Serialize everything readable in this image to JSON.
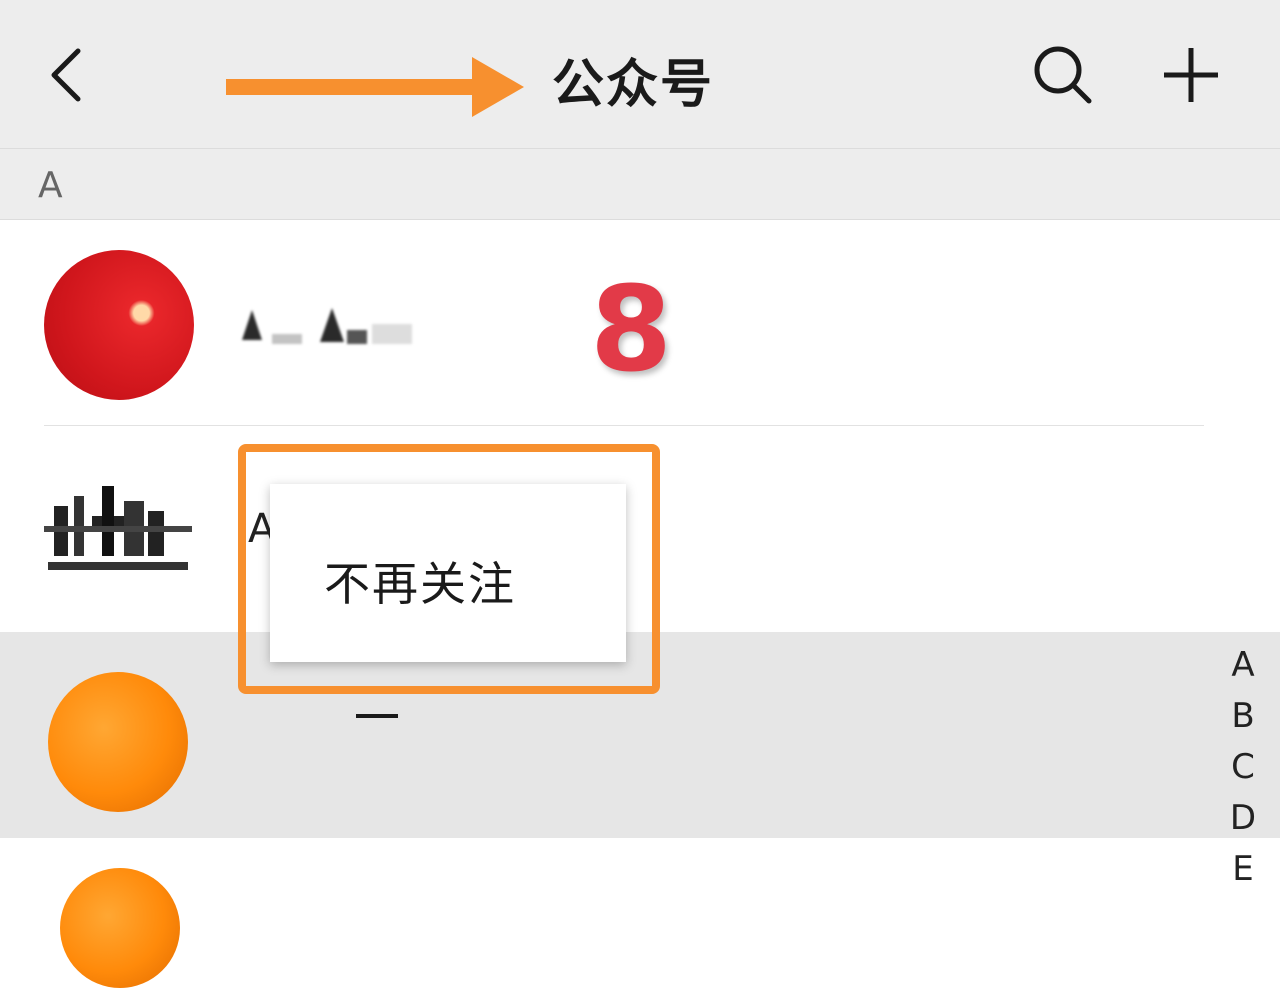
{
  "header": {
    "title": "公众号",
    "back_icon": "chevron-left-icon",
    "search_icon": "search-icon",
    "add_icon": "plus-icon"
  },
  "section": {
    "letter": "A"
  },
  "rows": [
    {
      "avatar": "red-avatar",
      "name": ""
    },
    {
      "avatar": "logo-avatar",
      "name": "A"
    },
    {
      "avatar": "orange-avatar",
      "name": ""
    },
    {
      "avatar": "orange-avatar",
      "name": ""
    }
  ],
  "annotation": {
    "count": "8",
    "arrow_color": "#f7902f",
    "count_color": "#e23a48"
  },
  "context_menu": {
    "item": "不再关注",
    "highlight_color": "#f7902f"
  },
  "index_bar": [
    "A",
    "B",
    "C",
    "D",
    "E"
  ]
}
